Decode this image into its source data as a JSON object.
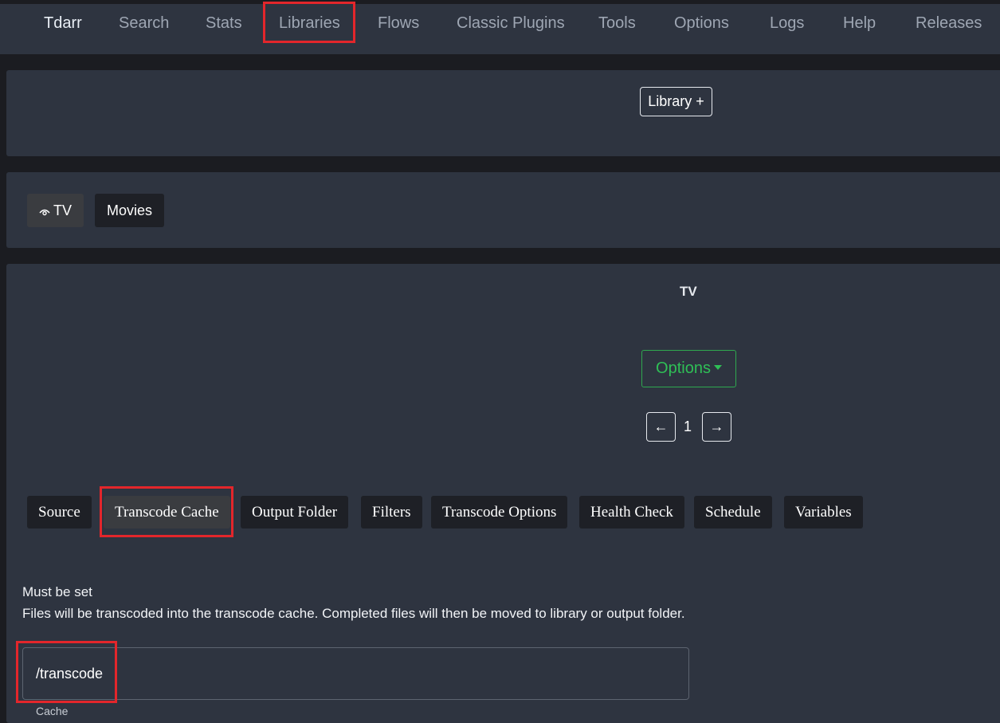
{
  "nav": {
    "items": [
      {
        "label": "Tdarr"
      },
      {
        "label": "Search"
      },
      {
        "label": "Stats"
      },
      {
        "label": "Libraries"
      },
      {
        "label": "Flows"
      },
      {
        "label": "Classic Plugins"
      },
      {
        "label": "Tools"
      },
      {
        "label": "Options"
      },
      {
        "label": "Logs"
      },
      {
        "label": "Help"
      },
      {
        "label": "Releases"
      }
    ],
    "active": "Libraries"
  },
  "library_bar": {
    "add_label": "Library +"
  },
  "libraries": {
    "items": [
      {
        "label": "TV",
        "icon": "eye-icon"
      },
      {
        "label": "Movies"
      }
    ],
    "selected": "TV"
  },
  "detail": {
    "title": "TV",
    "options_label": "Options",
    "pager": {
      "prev": "←",
      "page": "1",
      "next": "→"
    },
    "tabs": [
      {
        "label": "Source"
      },
      {
        "label": "Transcode Cache"
      },
      {
        "label": "Output Folder"
      },
      {
        "label": "Filters"
      },
      {
        "label": "Transcode Options"
      },
      {
        "label": "Health Check"
      },
      {
        "label": "Schedule"
      },
      {
        "label": "Variables"
      }
    ],
    "active_tab": "Transcode Cache",
    "cache": {
      "line1": "Must be set",
      "line2": "Files will be transcoded into the transcode cache. Completed files will then be moved to library or output folder.",
      "value": "/transcode",
      "label": "Cache"
    }
  },
  "colors": {
    "background": "#1b1c21",
    "panel": "#2e3440",
    "highlight": "#e3262b",
    "options_green": "#2fbf56"
  }
}
